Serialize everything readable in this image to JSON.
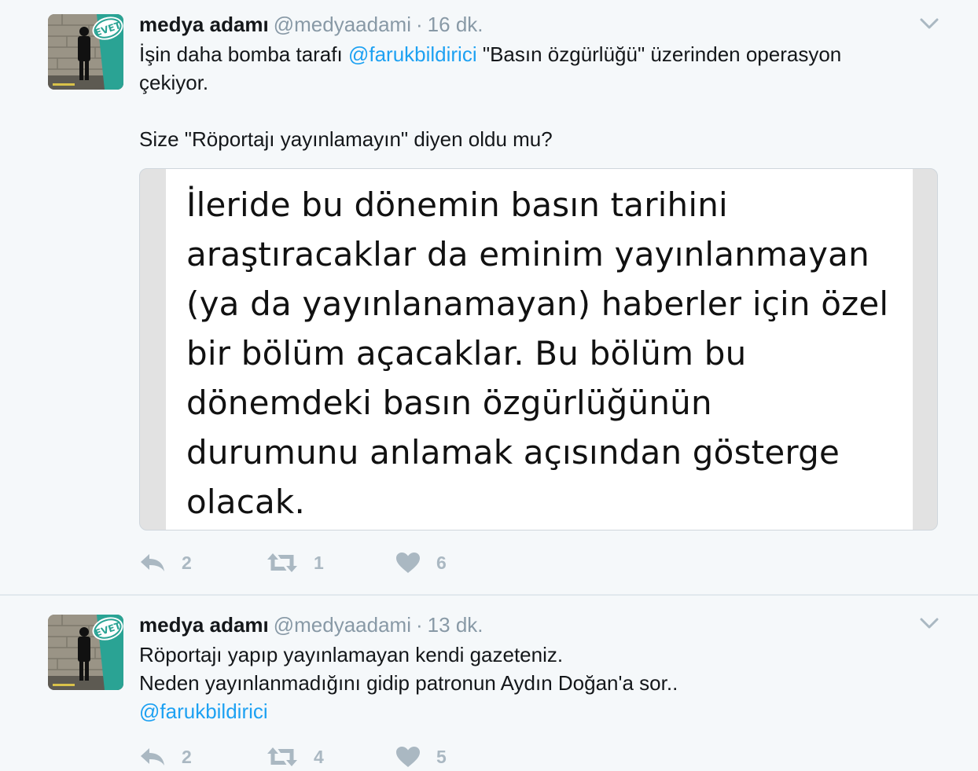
{
  "tweets": [
    {
      "name": "medya adamı",
      "handle": "@medyaadami",
      "separator": "·",
      "time": "16 dk.",
      "text_line1_before": "İşin daha bomba tarafı ",
      "text_line1_mention": "@farukbildirici",
      "text_line1_after": " \"Basın özgürlüğü\" üzerinden operasyon",
      "text_line2": "çekiyor.",
      "text_line3": "Size \"Röportajı yayınlamayın\" diyen oldu mu?",
      "image_text": "İleride bu dönemin basın tarihini\naraştıracaklar da eminim yayınlanmayan\n(ya da yayınlanamayan) haberler için özel\nbir bölüm açacaklar. Bu bölüm bu\ndönemdeki basın özgürlüğünün\ndurumunu anlamak açısından gösterge\nolacak.",
      "replies": "2",
      "retweets": "1",
      "likes": "6"
    },
    {
      "name": "medya adamı",
      "handle": "@medyaadami",
      "separator": "·",
      "time": "13 dk.",
      "text_line1": "Röportajı yapıp yayınlamayan kendi gazeteniz.",
      "text_line2": "Neden yayınlanmadığını gidip patronun Aydın Doğan'a sor..",
      "text_line3_mention": "@farukbildirici",
      "replies": "2",
      "retweets": "4",
      "likes": "5"
    }
  ],
  "avatar_badge": "EVET",
  "icons": {
    "reply": "reply-icon",
    "retweet": "retweet-icon",
    "like": "heart-icon",
    "caret": "chevron-down-icon"
  },
  "colors": {
    "background": "#f5f8fa",
    "text": "#14171a",
    "muted": "#8899a6",
    "mention": "#1da1f2",
    "action": "#aab8c2",
    "badge": "#2aa394"
  }
}
